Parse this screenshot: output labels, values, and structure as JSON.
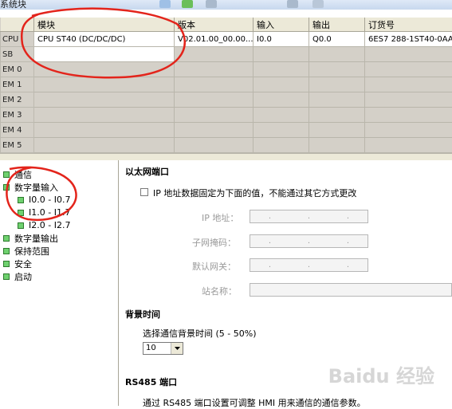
{
  "window": {
    "title": "系统块"
  },
  "table": {
    "headers": [
      "模块",
      "版本",
      "输入",
      "输出",
      "订货号"
    ],
    "rows": [
      {
        "id": "CPU",
        "module": "CPU ST40 (DC/DC/DC)",
        "version": "V02.01.00_00.00...",
        "input": "I0.0",
        "output": "Q0.0",
        "order": "6ES7 288-1ST40-0AA"
      },
      {
        "id": "SB",
        "module": "",
        "version": "",
        "input": "",
        "output": "",
        "order": ""
      },
      {
        "id": "EM 0",
        "module": "",
        "version": "",
        "input": "",
        "output": "",
        "order": ""
      },
      {
        "id": "EM 1",
        "module": "",
        "version": "",
        "input": "",
        "output": "",
        "order": ""
      },
      {
        "id": "EM 2",
        "module": "",
        "version": "",
        "input": "",
        "output": "",
        "order": ""
      },
      {
        "id": "EM 3",
        "module": "",
        "version": "",
        "input": "",
        "output": "",
        "order": ""
      },
      {
        "id": "EM 4",
        "module": "",
        "version": "",
        "input": "",
        "output": "",
        "order": ""
      },
      {
        "id": "EM 5",
        "module": "",
        "version": "",
        "input": "",
        "output": "",
        "order": ""
      }
    ]
  },
  "tree": {
    "items": [
      {
        "label": "通信",
        "level": 0
      },
      {
        "label": "数字量输入",
        "level": 0
      },
      {
        "label": "I0.0 - I0.7",
        "level": 1
      },
      {
        "label": "I1.0 - I1.7",
        "level": 1
      },
      {
        "label": "I2.0 - I2.7",
        "level": 1
      },
      {
        "label": "数字量输出",
        "level": 0
      },
      {
        "label": "保持范围",
        "level": 0
      },
      {
        "label": "安全",
        "level": 0
      },
      {
        "label": "启动",
        "level": 0
      }
    ]
  },
  "ethernet": {
    "heading": "以太网端口",
    "fixed_ip_label": "IP 地址数据固定为下面的值，不能通过其它方式更改",
    "fixed_ip_checked": false,
    "ip_label": "IP 地址：",
    "subnet_label": "子网掩码：",
    "gateway_label": "默认网关：",
    "station_label": "站名称：",
    "dot": "."
  },
  "background": {
    "heading": "背景时间",
    "select_label": "选择通信背景时间 (5 - 50%)",
    "value": "10"
  },
  "rs485": {
    "heading": "RS485 端口",
    "desc": "通过 RS485 端口设置可调整 HMI 用来通信的通信参数。"
  },
  "watermark": "Baidu 经验",
  "colors": {
    "annotation": "#e3241b",
    "node_green": "#6fd16f",
    "grid_bg": "#d4d0c8"
  }
}
